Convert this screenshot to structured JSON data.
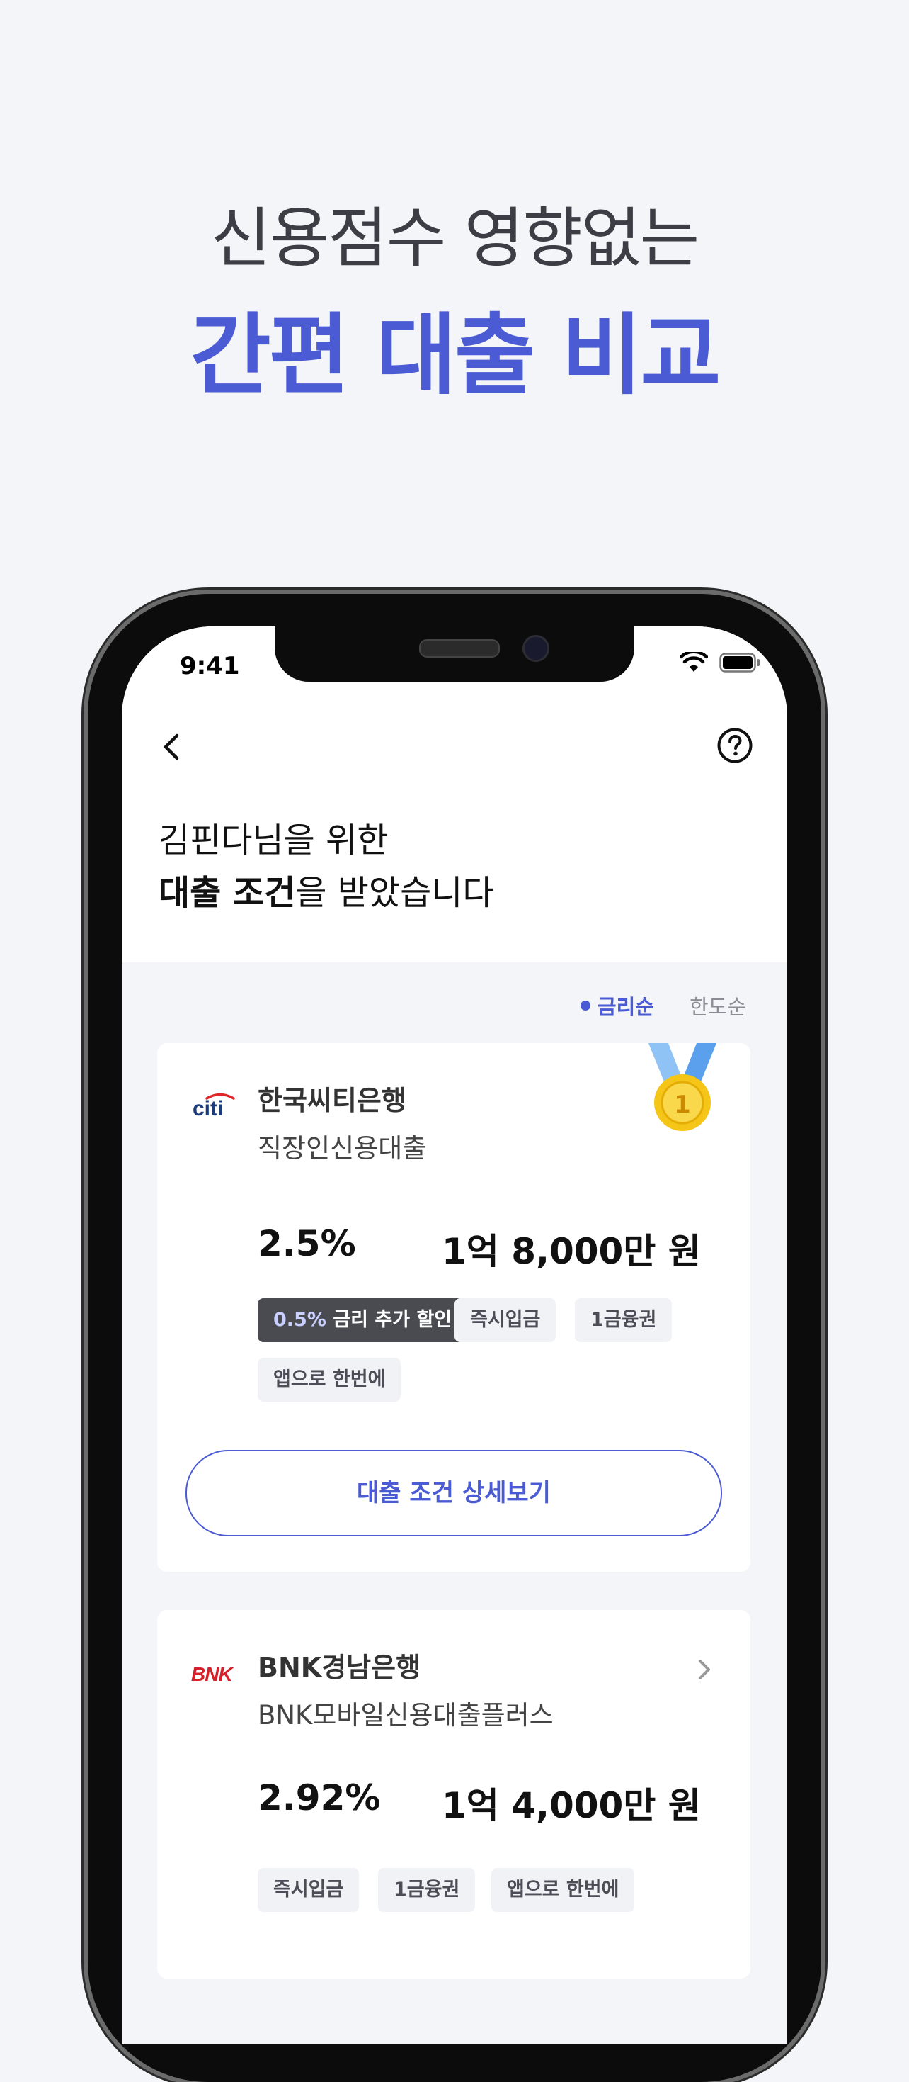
{
  "promo": {
    "headline_top": "신용점수 영향없는",
    "headline_main": "간편 대출 비교"
  },
  "status_bar": {
    "time": "9:41",
    "icons": [
      "wifi-icon",
      "battery-icon"
    ]
  },
  "nav": {
    "back_icon": "chevron-left-icon",
    "help_icon": "question-circle-icon"
  },
  "greeting": {
    "line1": "김핀다님을 위한",
    "line2_bold": "대출 조건",
    "line2_rest": "을 받았습니다"
  },
  "sort": {
    "active": "금리순",
    "inactive": "한도순"
  },
  "offers": [
    {
      "logo_text": "citi",
      "bank": "한국씨티은행",
      "product": "직장인신용대출",
      "rate": "2.5%",
      "limit": "1억 8,000만 원",
      "badge": "1",
      "tags": [
        {
          "highlight": "0.5%",
          "text": " 금리 추가 할인"
        },
        {
          "text": "즉시입금"
        },
        {
          "text": "1금융권"
        },
        {
          "text": "앱으로 한번에"
        }
      ],
      "detail_button": "대출 조건 상세보기"
    },
    {
      "logo_text": "BNK",
      "bank": "BNK경남은행",
      "product": "BNK모바일신용대출플러스",
      "rate": "2.92%",
      "limit": "1억 4,000만 원",
      "tags": [
        {
          "text": "즉시입금"
        },
        {
          "text": "1금융권"
        },
        {
          "text": "앱으로 한번에"
        }
      ]
    }
  ],
  "colors": {
    "accent": "#4a5bd4",
    "background": "#f4f5f9",
    "citi_blue": "#1c3d7a",
    "citi_red": "#e0262b",
    "bnk_red": "#d6202a",
    "medal_gold": "#f5c518",
    "ribbon_blue": "#8fc3f5"
  }
}
